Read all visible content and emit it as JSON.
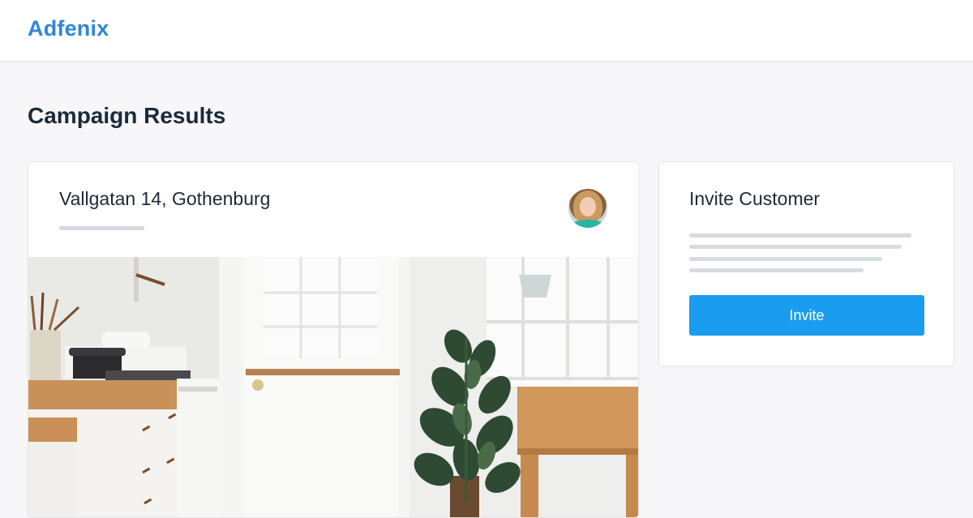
{
  "app": {
    "brand": "Adfenix"
  },
  "page": {
    "title": "Campaign Results"
  },
  "campaign_card": {
    "address": "Vallgatan 14, Gothenburg",
    "avatar_icon": "agent-avatar",
    "photo_icon": "kitchen-photo"
  },
  "invite_card": {
    "title": "Invite Customer",
    "button_label": "Invite"
  },
  "colors": {
    "brand": "#2f86d9",
    "button": "#1a9cf0",
    "placeholder": "#d6dae2",
    "background": "#f7f7f9"
  }
}
